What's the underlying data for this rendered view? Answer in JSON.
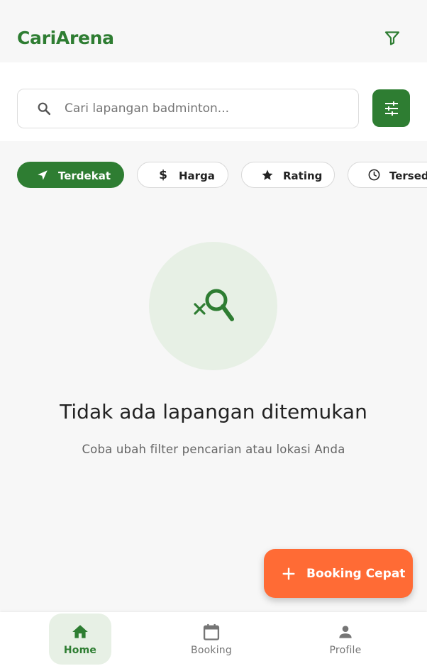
{
  "app": {
    "title": "CariArena"
  },
  "search": {
    "placeholder": "Cari lapangan badminton..."
  },
  "chips": [
    {
      "label": "Terdekat",
      "icon": "navigation-icon",
      "active": true
    },
    {
      "label": "Harga",
      "icon": "dollar-icon",
      "active": false
    },
    {
      "label": "Rating",
      "icon": "star-icon",
      "active": false
    },
    {
      "label": "Tersedia",
      "icon": "clock-icon",
      "active": false
    }
  ],
  "empty": {
    "icon": "search-off-icon",
    "title": "Tidak ada lapangan ditemukan",
    "subtitle": "Coba ubah filter pencarian atau lokasi Anda"
  },
  "fab": {
    "label": "Booking Cepat",
    "icon": "plus-icon"
  },
  "bottom_nav": [
    {
      "label": "Home",
      "icon": "home-icon",
      "active": true
    },
    {
      "label": "Booking",
      "icon": "calendar-icon",
      "active": false
    },
    {
      "label": "Profile",
      "icon": "person-icon",
      "active": false
    }
  ],
  "colors": {
    "primary": "#2e7d32",
    "accent": "#ff6b35",
    "primary_light": "#e7f0e5"
  }
}
